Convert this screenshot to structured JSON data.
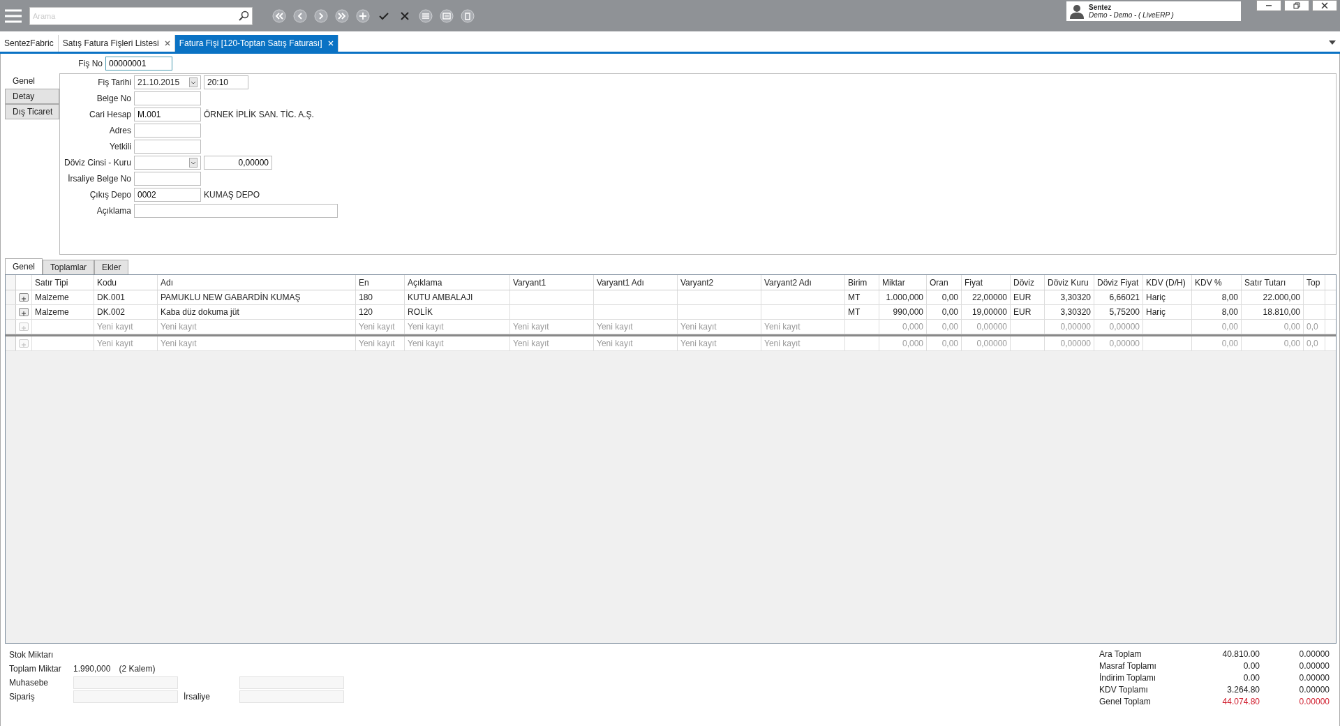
{
  "toolbar": {
    "search": {
      "placeholder": "Arama"
    },
    "user": {
      "name": "Sentez",
      "detail": "Demo - Demo - ( LiveERP )"
    }
  },
  "doc_tabs": [
    {
      "label": "SentezFabric",
      "selected": false,
      "closable": false
    },
    {
      "label": "Satış Fatura Fişleri Listesi",
      "selected": false,
      "closable": true
    },
    {
      "label": "Fatura Fişi  [120-Toptan Satış Faturası]",
      "selected": true,
      "closable": true
    }
  ],
  "fis_no": {
    "label": "Fiş No",
    "value": "00000001"
  },
  "side_tabs": [
    {
      "label": "Genel",
      "selected": true
    },
    {
      "label": "Detay",
      "selected": false
    },
    {
      "label": "Dış Ticaret",
      "selected": false
    }
  ],
  "fields": [
    {
      "label": "Fiş Tarihi",
      "kind": "combo",
      "value": "21.10.2015",
      "extra_value": "20:10"
    },
    {
      "label": "Belge No",
      "kind": "text"
    },
    {
      "label": "Cari Hesap",
      "kind": "text",
      "value": "M.001",
      "note": "ÖRNEK İPLİK SAN. TİC. A.Ş."
    },
    {
      "label": "Adres",
      "kind": "text"
    },
    {
      "label": "Yetkili",
      "kind": "text"
    },
    {
      "label": "Döviz Cinsi - Kuru",
      "kind": "combo",
      "extra_value": "0,00000"
    },
    {
      "label": "İrsaliye Belge No",
      "kind": "text"
    },
    {
      "label": "Çıkış Depo",
      "kind": "text",
      "value": "0002",
      "note": "KUMAŞ DEPO"
    },
    {
      "label": "Açıklama",
      "kind": "wide"
    }
  ],
  "grid_tabs": [
    {
      "label": "Genel",
      "selected": true
    },
    {
      "label": "Toplamlar",
      "selected": false
    },
    {
      "label": "Ekler",
      "selected": false
    }
  ],
  "table": {
    "columns": [
      "Satır Tipi",
      "Kodu",
      "Adı",
      "En",
      "Açıklama",
      "Varyant1",
      "Varyant1 Adı",
      "Varyant2",
      "Varyant2 Adı",
      "Birim",
      "Miktar",
      "Oran",
      "Fiyat",
      "Döviz",
      "Döviz Kuru",
      "Döviz Fiyat",
      "KDV (D/H)",
      "KDV %",
      "Satır Tutarı",
      "Top"
    ],
    "rows": [
      {
        "kind": "item",
        "cells": [
          "Malzeme",
          "DK.001",
          "PAMUKLU NEW GABARDİN KUMAŞ",
          "180",
          "KUTU AMBALAJI",
          "",
          "",
          "",
          "",
          "MT",
          "1.000,000",
          "0,00",
          "22,00000",
          "EUR",
          "3,30320",
          "6,66021",
          "Hariç",
          "8,00",
          "22.000,00",
          ""
        ]
      },
      {
        "kind": "item",
        "cells": [
          "Malzeme",
          "DK.002",
          "Kaba düz dokuma jüt",
          "120",
          "ROLİK",
          "",
          "",
          "",
          "",
          "MT",
          "990,000",
          "0,00",
          "19,00000",
          "EUR",
          "3,30320",
          "5,75200",
          "Hariç",
          "8,00",
          "18.810,00",
          ""
        ]
      },
      {
        "kind": "new",
        "cells": [
          "",
          "Yeni kayıt",
          "Yeni kayıt",
          "Yeni kayıt",
          "Yeni kayıt",
          "Yeni kayıt",
          "Yeni kayıt",
          "Yeni kayıt",
          "Yeni kayıt",
          "",
          "0,000",
          "0,00",
          "0,00000",
          "",
          "0,00000",
          "0,00000",
          "",
          "0,00",
          "0,00",
          "0,0"
        ]
      },
      {
        "kind": "append",
        "cells": [
          "",
          "Yeni kayıt",
          "Yeni kayıt",
          "Yeni kayıt",
          "Yeni kayıt",
          "Yeni kayıt",
          "Yeni kayıt",
          "Yeni kayıt",
          "Yeni kayıt",
          "",
          "0,000",
          "0,00",
          "0,00000",
          "",
          "0,00000",
          "0,00000",
          "",
          "0,00",
          "0,00",
          "0,0"
        ]
      }
    ]
  },
  "summary": {
    "stok_label": "Stok Miktarı",
    "toplam_label": "Toplam Miktar",
    "toplam_value": "1.990,000",
    "toplam_count": "(2 Kalem)",
    "muhasebe_label": "Muhasebe",
    "siparis_label": "Sipariş",
    "irsaliye_label": "İrsaliye"
  },
  "totals": [
    {
      "label": "Ara Toplam",
      "value": "40.810.00",
      "value_2": "0.00000",
      "highlight": false
    },
    {
      "label": "Masraf Toplamı",
      "value": "0.00",
      "value_2": "0.00000",
      "highlight": false
    },
    {
      "label": "İndirim Toplamı",
      "value": "0.00",
      "value_2": "0.00000",
      "highlight": false
    },
    {
      "label": "KDV Toplamı",
      "value": "3.264.80",
      "value_2": "0.00000",
      "highlight": false
    },
    {
      "label": "Genel Toplam",
      "value": "44.074.80",
      "value_2": "0.00000",
      "highlight": true
    }
  ]
}
